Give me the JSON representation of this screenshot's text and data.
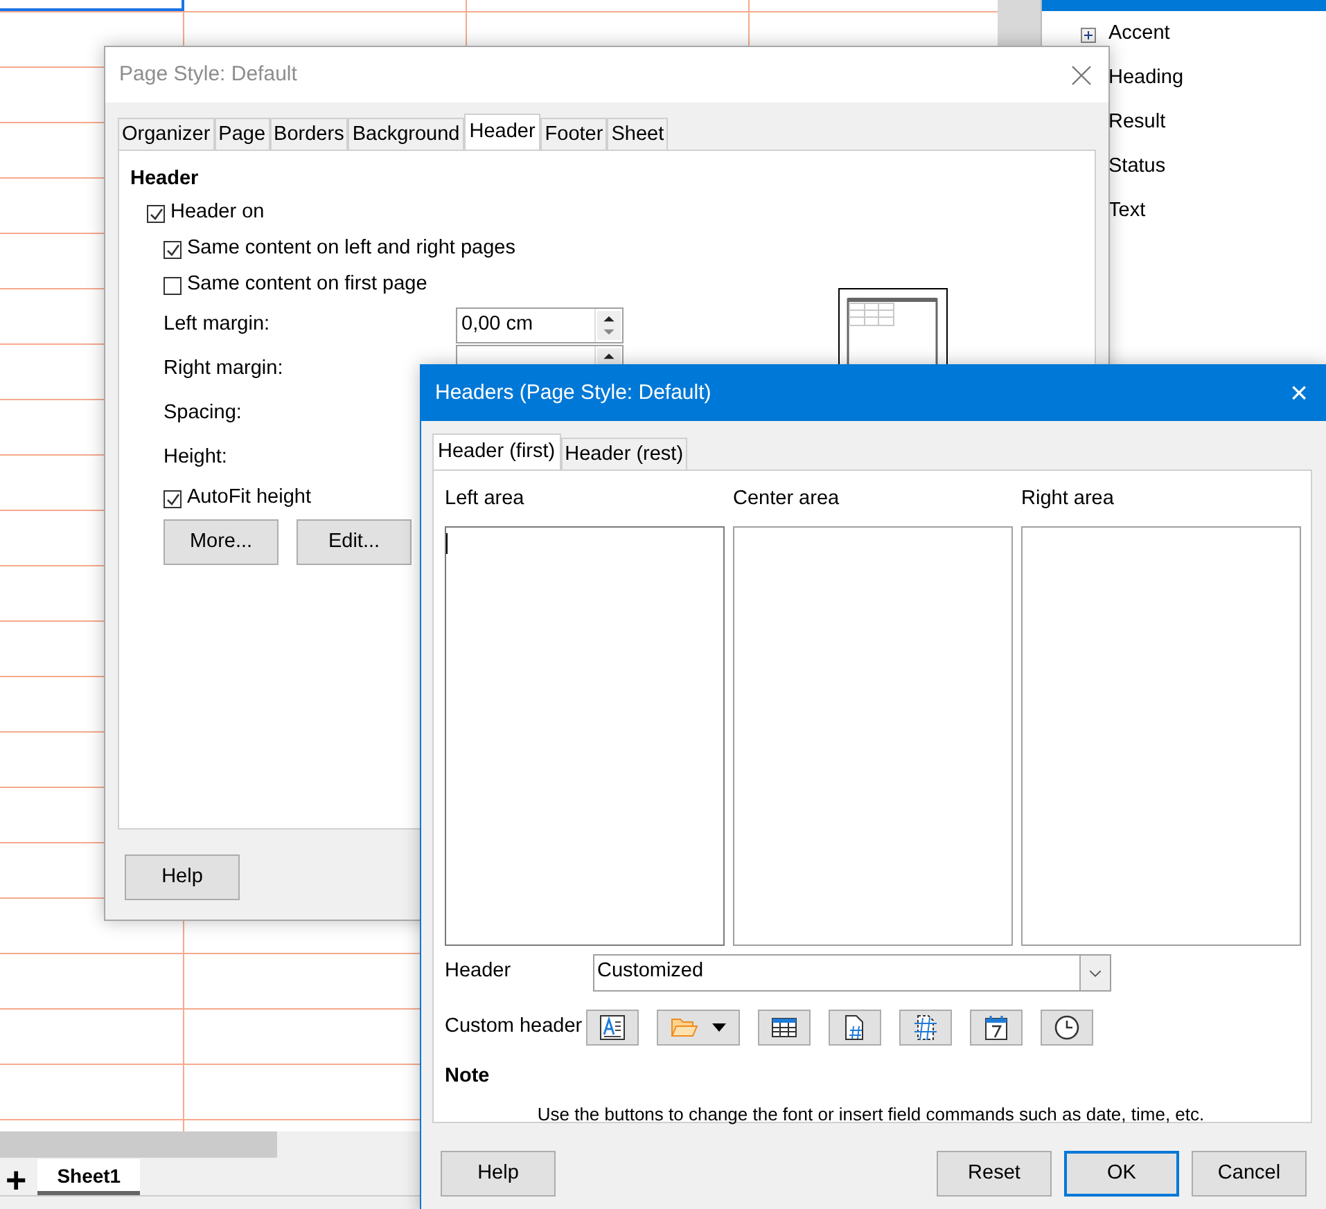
{
  "spreadsheet": {
    "add_sheet": "+",
    "sheet_tabs": [
      {
        "label": "Sheet1",
        "selected": true
      }
    ]
  },
  "styles_panel": {
    "items": [
      {
        "label": "Accent",
        "expandable": true
      },
      {
        "label": "Heading"
      },
      {
        "label": "Result"
      },
      {
        "label": "Status"
      },
      {
        "label": "Text"
      }
    ]
  },
  "page_style_dialog": {
    "title": "Page Style: Default",
    "tabs": [
      {
        "label": "Organizer",
        "selected": false
      },
      {
        "label": "Page",
        "selected": false
      },
      {
        "label": "Borders",
        "selected": false
      },
      {
        "label": "Background",
        "selected": false
      },
      {
        "label": "Header",
        "selected": true
      },
      {
        "label": "Footer",
        "selected": false
      },
      {
        "label": "Sheet",
        "selected": false
      }
    ],
    "section": "Header",
    "header_on": {
      "label": "Header on",
      "checked": true
    },
    "options": [
      {
        "kind": "checkbox",
        "label": "Same content on left and right pages",
        "checked": true
      },
      {
        "kind": "checkbox",
        "label": "Same content on first page",
        "checked": false
      },
      {
        "kind": "field",
        "label": "Left margin:",
        "value": "0,00 cm"
      },
      {
        "kind": "field",
        "label": "Right margin:"
      },
      {
        "kind": "label",
        "label": "Spacing:"
      },
      {
        "kind": "label",
        "label": "Height:"
      },
      {
        "kind": "checkbox",
        "label": "AutoFit height",
        "checked": true
      }
    ],
    "buttons": [
      "More...",
      "Edit..."
    ],
    "help": "Help"
  },
  "headers_dialog": {
    "title": "Headers (Page Style: Default)",
    "close": "×",
    "tabs": [
      {
        "label": "Header (first)",
        "selected": true
      },
      {
        "label": "Header (rest)",
        "selected": false
      }
    ],
    "areas": [
      {
        "label": "Left area",
        "focused": true
      },
      {
        "label": "Center area",
        "focused": false
      },
      {
        "label": "Right area",
        "focused": false
      }
    ],
    "header_label": "Header",
    "header_value": "Customized",
    "custom_label": "Custom header",
    "tools": [
      {
        "kind": "font"
      },
      {
        "kind": "folder"
      },
      {
        "kind": "table"
      },
      {
        "kind": "page"
      },
      {
        "kind": "pages"
      },
      {
        "kind": "date"
      },
      {
        "kind": "time"
      }
    ],
    "note_title": "Note",
    "note_text": "Use the buttons to change the font or insert field commands such as date, time, etc.",
    "help": "Help",
    "buttons": [
      {
        "label": "Reset",
        "default": false
      },
      {
        "label": "OK",
        "default": true
      },
      {
        "label": "Cancel",
        "default": false
      }
    ]
  }
}
